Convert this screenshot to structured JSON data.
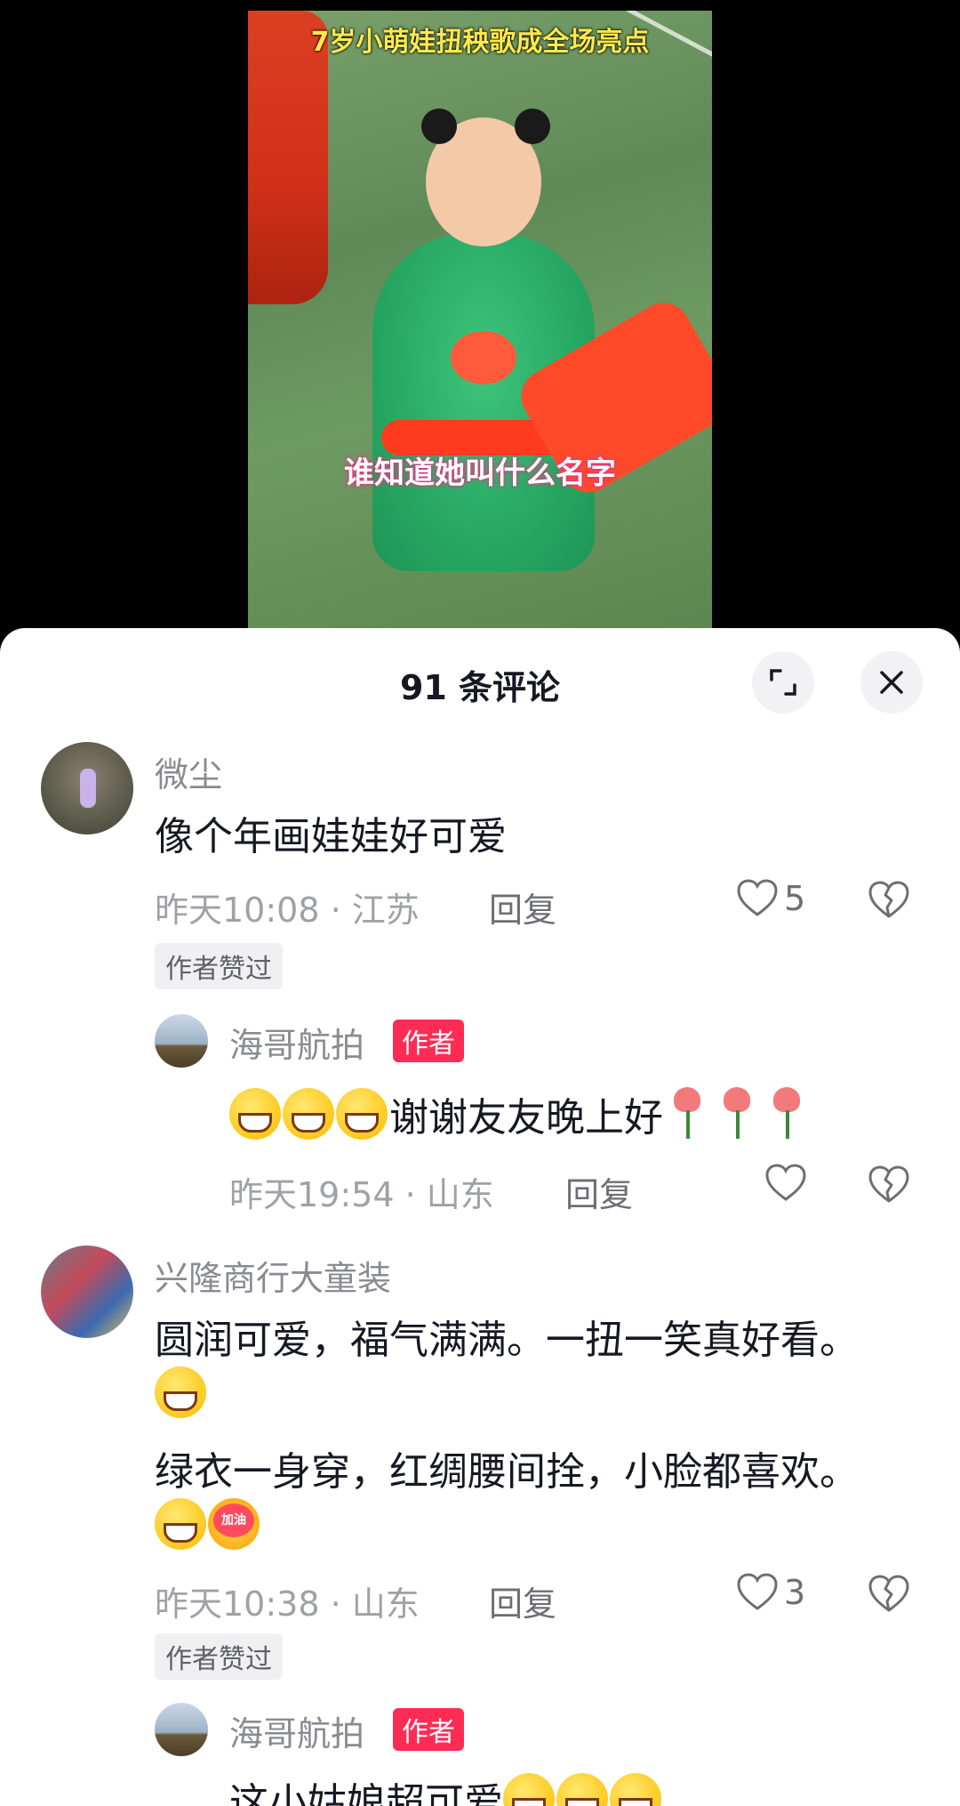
{
  "video": {
    "title": "7岁小萌娃扭秧歌成全场亮点",
    "caption": "谁知道她叫什么名字"
  },
  "sheet": {
    "title": "91 条评论",
    "expand_icon": "expand-icon",
    "close_icon": "close-icon"
  },
  "comments": [
    {
      "user": "微尘",
      "text": "像个年画娃娃好可爱",
      "meta": "昨天10:08 · 江苏",
      "reply_label": "回复",
      "likes": "5",
      "badge": "作者赞过",
      "reply": {
        "user": "海哥航拍",
        "tag": "作者",
        "text": "谢谢友友晚上好",
        "meta": "昨天19:54 · 山东",
        "reply_label": "回复"
      }
    },
    {
      "user": "兴隆商行大童装",
      "text_line1": "圆润可爱，福气满满。一扭一笑真好看。",
      "text_line2": "绿衣一身穿，红绸腰间拴，小脸都喜欢。",
      "emoji_jiayou": "加油",
      "meta": "昨天10:38 · 山东",
      "reply_label": "回复",
      "likes": "3",
      "badge": "作者赞过",
      "reply": {
        "user": "海哥航拍",
        "tag": "作者",
        "text": "这小姑娘超可爱"
      }
    }
  ]
}
